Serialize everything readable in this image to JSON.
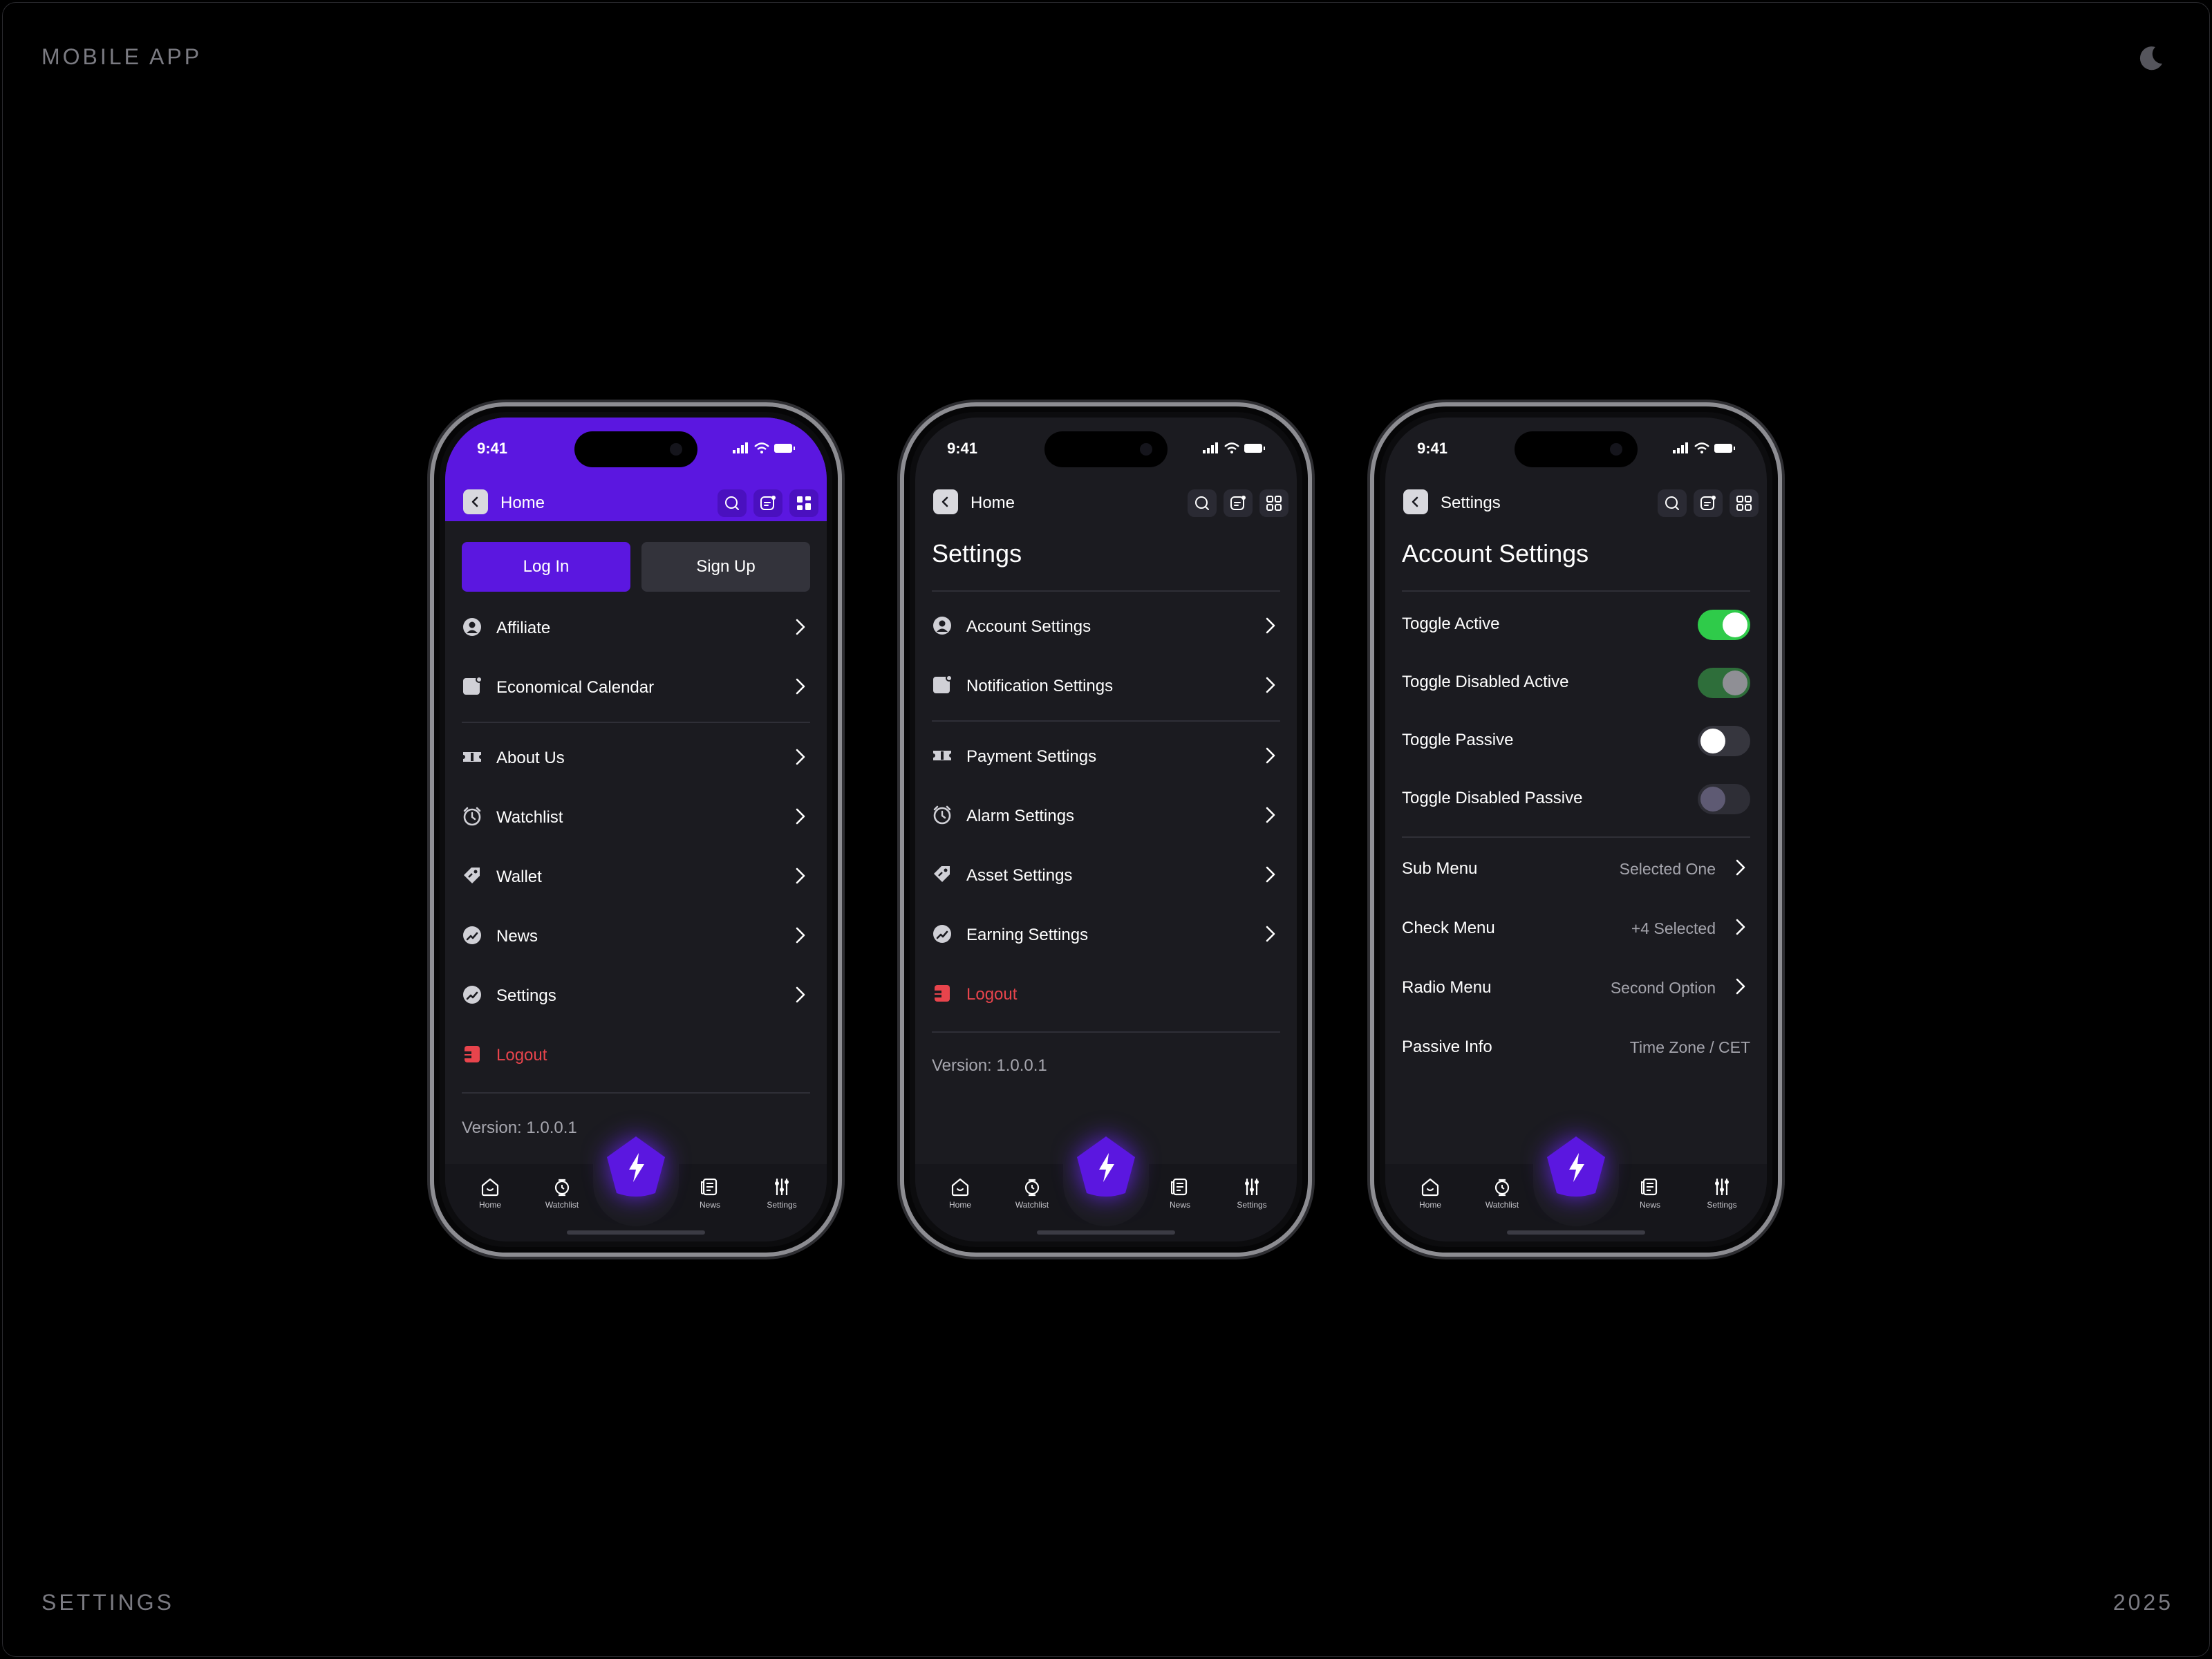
{
  "page": {
    "top_left": "MOBILE APP",
    "bottom_left": "SETTINGS",
    "bottom_right": "2025"
  },
  "status_time": "9:41",
  "tabbar": {
    "home": "Home",
    "watchlist": "Watchlist",
    "news": "News",
    "settings": "Settings"
  },
  "phone1": {
    "title": "Home",
    "login": "Log In",
    "signup": "Sign Up",
    "items": {
      "affiliate": "Affiliate",
      "calendar": "Economical Calendar",
      "about": "About Us",
      "watchlist": "Watchlist",
      "wallet": "Wallet",
      "news": "News",
      "settings": "Settings",
      "logout": "Logout"
    },
    "version": "Version: 1.0.0.1"
  },
  "phone2": {
    "title": "Home",
    "heading": "Settings",
    "items": {
      "account": "Account Settings",
      "notification": "Notification Settings",
      "payment": "Payment Settings",
      "alarm": "Alarm Settings",
      "asset": "Asset Settings",
      "earning": "Earning Settings",
      "logout": "Logout"
    },
    "version": "Version: 1.0.0.1"
  },
  "phone3": {
    "title": "Settings",
    "heading": "Account Settings",
    "toggles": {
      "active": {
        "label": "Toggle Active",
        "on": true,
        "disabled": false
      },
      "disabled_active": {
        "label": "Toggle Disabled Active",
        "on": true,
        "disabled": true
      },
      "passive": {
        "label": "Toggle Passive",
        "on": false,
        "disabled": false
      },
      "disabled_passive": {
        "label": "Toggle Disabled Passive",
        "on": false,
        "disabled": true
      }
    },
    "menus": {
      "sub": {
        "label": "Sub Menu",
        "value": "Selected One"
      },
      "check": {
        "label": "Check Menu",
        "value": "+4 Selected"
      },
      "radio": {
        "label": "Radio Menu",
        "value": "Second Option"
      },
      "passive": {
        "label": "Passive Info",
        "value": "Time Zone / CET"
      }
    }
  },
  "colors": {
    "accent": "#5b17e0",
    "danger": "#e8444c",
    "toggle_on": "#2fcb4a",
    "surface": "#1b1b20"
  }
}
